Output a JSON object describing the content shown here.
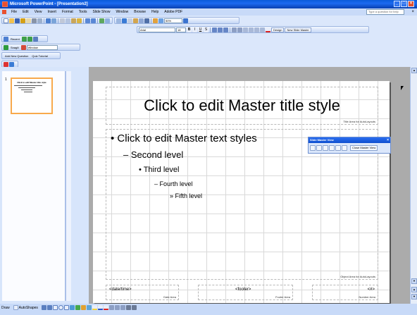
{
  "window": {
    "title": "Microsoft PowerPoint - [Presentation2]"
  },
  "menubar": {
    "items": [
      "File",
      "Edit",
      "View",
      "Insert",
      "Format",
      "Tools",
      "Slide Show",
      "Window",
      "Browse",
      "Help",
      "Adobe PDF"
    ],
    "help_placeholder": "Type a question for help"
  },
  "toolbars": {
    "font_name": "Arial",
    "font_size": "18",
    "zoom": "50%",
    "design_label": "Design",
    "new_slide_master_label": "New Slide Master",
    "recent_label": "Recent",
    "window_label": "Window",
    "add_new_question_label": "Add New Question",
    "quiz_tutorial_label": "Quiz Tutorial",
    "snagit_label": "SnagIt"
  },
  "thumbnails": [
    {
      "number": "1",
      "title": "Click to edit Master title style"
    }
  ],
  "slide": {
    "title_text": "Click to edit Master title style",
    "title_area_label": "Title Area for AutoLayouts",
    "body_levels": [
      "• Click to edit Master text styles",
      "– Second level",
      "• Third level",
      "– Fourth level",
      "» Fifth level"
    ],
    "object_area_label": "Object Area for AutoLayouts",
    "date_text": "<date/time>",
    "date_area_label": "Date Area",
    "footer_text": "<footer>",
    "footer_area_label": "Footer Area",
    "number_text": "<#>",
    "number_area_label": "Number Area"
  },
  "slide_master_toolbar": {
    "title": "Slide Master View",
    "close_label": "Close Master View"
  },
  "drawing_bar": {
    "draw_label": "Draw",
    "autoshapes_label": "AutoShapes"
  },
  "colors": {
    "titlebar": "#0a5bd9",
    "toolbar": "#c8daf8",
    "edit_background": "#ababab",
    "thumb_selection": "#f8a94c"
  }
}
